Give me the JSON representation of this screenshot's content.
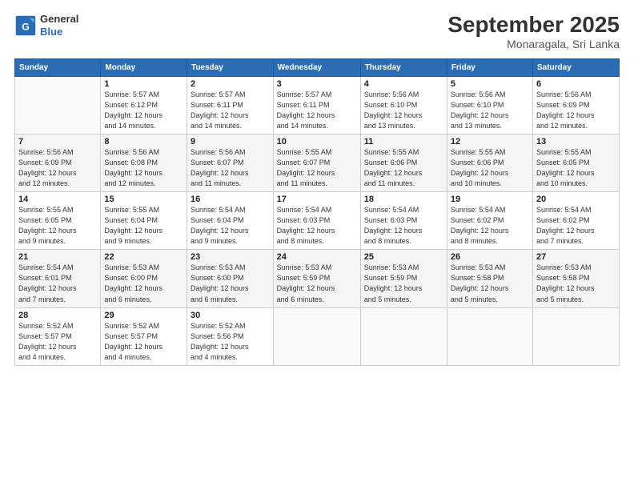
{
  "header": {
    "logo_line1": "General",
    "logo_line2": "Blue",
    "month": "September 2025",
    "location": "Monaragala, Sri Lanka"
  },
  "days_of_week": [
    "Sunday",
    "Monday",
    "Tuesday",
    "Wednesday",
    "Thursday",
    "Friday",
    "Saturday"
  ],
  "weeks": [
    [
      {
        "day": "",
        "info": ""
      },
      {
        "day": "1",
        "info": "Sunrise: 5:57 AM\nSunset: 6:12 PM\nDaylight: 12 hours\nand 14 minutes."
      },
      {
        "day": "2",
        "info": "Sunrise: 5:57 AM\nSunset: 6:11 PM\nDaylight: 12 hours\nand 14 minutes."
      },
      {
        "day": "3",
        "info": "Sunrise: 5:57 AM\nSunset: 6:11 PM\nDaylight: 12 hours\nand 14 minutes."
      },
      {
        "day": "4",
        "info": "Sunrise: 5:56 AM\nSunset: 6:10 PM\nDaylight: 12 hours\nand 13 minutes."
      },
      {
        "day": "5",
        "info": "Sunrise: 5:56 AM\nSunset: 6:10 PM\nDaylight: 12 hours\nand 13 minutes."
      },
      {
        "day": "6",
        "info": "Sunrise: 5:56 AM\nSunset: 6:09 PM\nDaylight: 12 hours\nand 12 minutes."
      }
    ],
    [
      {
        "day": "7",
        "info": "Sunrise: 5:56 AM\nSunset: 6:09 PM\nDaylight: 12 hours\nand 12 minutes."
      },
      {
        "day": "8",
        "info": "Sunrise: 5:56 AM\nSunset: 6:08 PM\nDaylight: 12 hours\nand 12 minutes."
      },
      {
        "day": "9",
        "info": "Sunrise: 5:56 AM\nSunset: 6:07 PM\nDaylight: 12 hours\nand 11 minutes."
      },
      {
        "day": "10",
        "info": "Sunrise: 5:55 AM\nSunset: 6:07 PM\nDaylight: 12 hours\nand 11 minutes."
      },
      {
        "day": "11",
        "info": "Sunrise: 5:55 AM\nSunset: 6:06 PM\nDaylight: 12 hours\nand 11 minutes."
      },
      {
        "day": "12",
        "info": "Sunrise: 5:55 AM\nSunset: 6:06 PM\nDaylight: 12 hours\nand 10 minutes."
      },
      {
        "day": "13",
        "info": "Sunrise: 5:55 AM\nSunset: 6:05 PM\nDaylight: 12 hours\nand 10 minutes."
      }
    ],
    [
      {
        "day": "14",
        "info": "Sunrise: 5:55 AM\nSunset: 6:05 PM\nDaylight: 12 hours\nand 9 minutes."
      },
      {
        "day": "15",
        "info": "Sunrise: 5:55 AM\nSunset: 6:04 PM\nDaylight: 12 hours\nand 9 minutes."
      },
      {
        "day": "16",
        "info": "Sunrise: 5:54 AM\nSunset: 6:04 PM\nDaylight: 12 hours\nand 9 minutes."
      },
      {
        "day": "17",
        "info": "Sunrise: 5:54 AM\nSunset: 6:03 PM\nDaylight: 12 hours\nand 8 minutes."
      },
      {
        "day": "18",
        "info": "Sunrise: 5:54 AM\nSunset: 6:03 PM\nDaylight: 12 hours\nand 8 minutes."
      },
      {
        "day": "19",
        "info": "Sunrise: 5:54 AM\nSunset: 6:02 PM\nDaylight: 12 hours\nand 8 minutes."
      },
      {
        "day": "20",
        "info": "Sunrise: 5:54 AM\nSunset: 6:02 PM\nDaylight: 12 hours\nand 7 minutes."
      }
    ],
    [
      {
        "day": "21",
        "info": "Sunrise: 5:54 AM\nSunset: 6:01 PM\nDaylight: 12 hours\nand 7 minutes."
      },
      {
        "day": "22",
        "info": "Sunrise: 5:53 AM\nSunset: 6:00 PM\nDaylight: 12 hours\nand 6 minutes."
      },
      {
        "day": "23",
        "info": "Sunrise: 5:53 AM\nSunset: 6:00 PM\nDaylight: 12 hours\nand 6 minutes."
      },
      {
        "day": "24",
        "info": "Sunrise: 5:53 AM\nSunset: 5:59 PM\nDaylight: 12 hours\nand 6 minutes."
      },
      {
        "day": "25",
        "info": "Sunrise: 5:53 AM\nSunset: 5:59 PM\nDaylight: 12 hours\nand 5 minutes."
      },
      {
        "day": "26",
        "info": "Sunrise: 5:53 AM\nSunset: 5:58 PM\nDaylight: 12 hours\nand 5 minutes."
      },
      {
        "day": "27",
        "info": "Sunrise: 5:53 AM\nSunset: 5:58 PM\nDaylight: 12 hours\nand 5 minutes."
      }
    ],
    [
      {
        "day": "28",
        "info": "Sunrise: 5:52 AM\nSunset: 5:57 PM\nDaylight: 12 hours\nand 4 minutes."
      },
      {
        "day": "29",
        "info": "Sunrise: 5:52 AM\nSunset: 5:57 PM\nDaylight: 12 hours\nand 4 minutes."
      },
      {
        "day": "30",
        "info": "Sunrise: 5:52 AM\nSunset: 5:56 PM\nDaylight: 12 hours\nand 4 minutes."
      },
      {
        "day": "",
        "info": ""
      },
      {
        "day": "",
        "info": ""
      },
      {
        "day": "",
        "info": ""
      },
      {
        "day": "",
        "info": ""
      }
    ]
  ]
}
